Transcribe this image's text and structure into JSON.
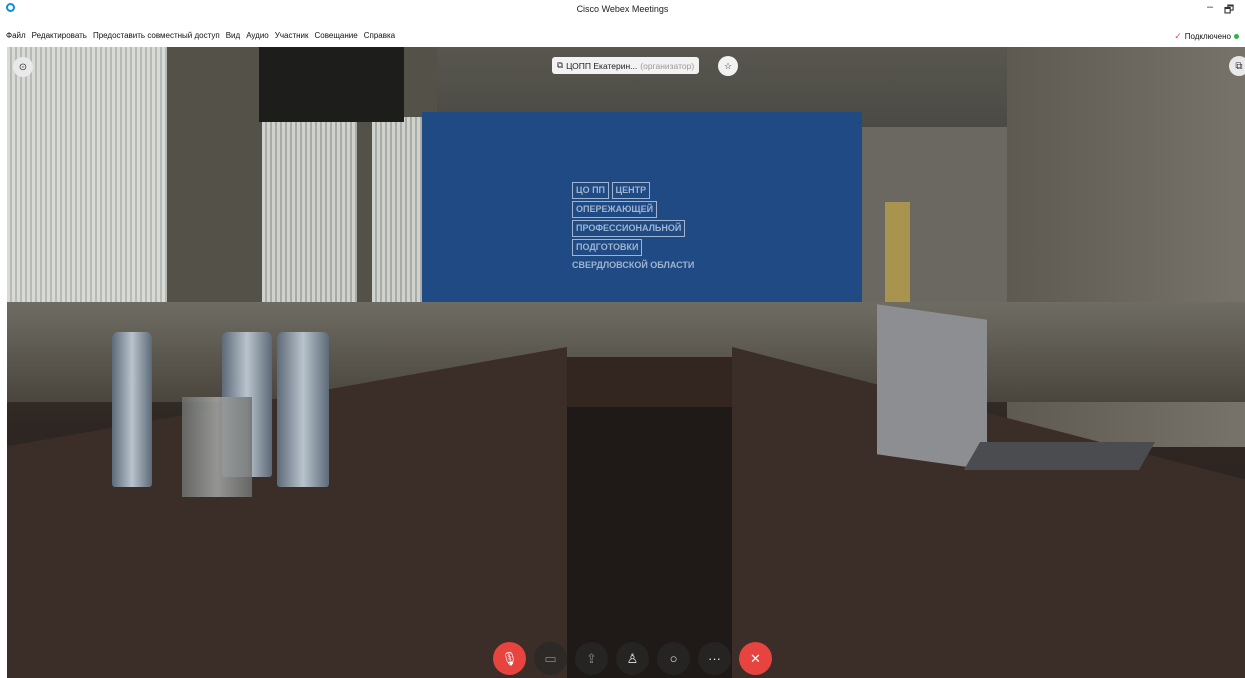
{
  "window": {
    "title": "Cisco Webex Meetings",
    "minimize": "–",
    "restore": "🗗"
  },
  "menu": {
    "items": [
      "Файл",
      "Редактировать",
      "Предоставить совместный доступ",
      "Вид",
      "Аудио",
      "Участник",
      "Совещание",
      "Справка"
    ],
    "status": "Подключено"
  },
  "video": {
    "speaker_name": "ЦОПП Екатерин...",
    "speaker_role": "(организатор)",
    "wall_logo": [
      "ЦЕНТР",
      "ОПЕРЕЖАЮЩЕЙ",
      "ПРОФЕССИОНАЛЬНОЙ",
      "ПОДГОТОВКИ",
      "СВЕРДЛОВСКОЙ ОБЛАСТИ"
    ],
    "logo_mark": "ЦО ПП"
  },
  "controls": {
    "mute_icon": "mic-muted-icon",
    "video_icon": "video-off-icon",
    "share_icon": "share-icon",
    "participants_icon": "participants-icon",
    "chat_icon": "chat-icon",
    "more_label": "···",
    "leave_icon": "close-icon",
    "accent": "#e8443f"
  }
}
